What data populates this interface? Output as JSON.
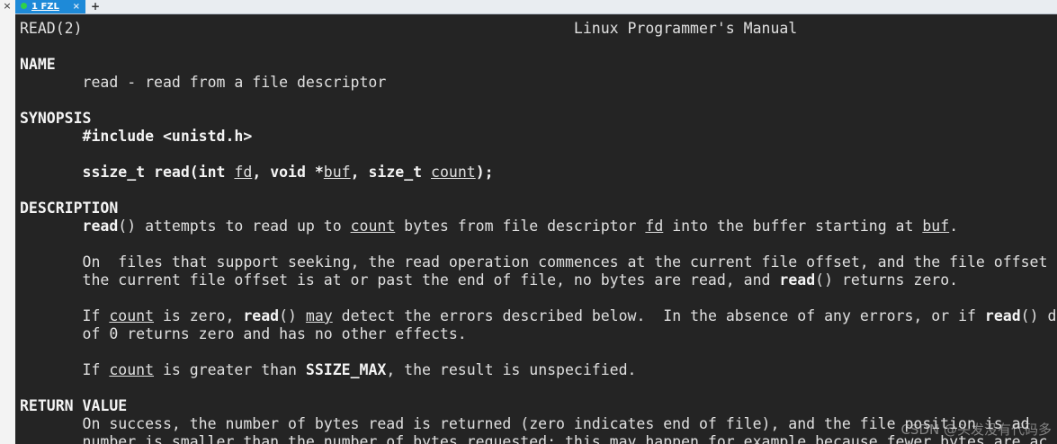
{
  "window": {
    "gutter_close": "×"
  },
  "tabs": [
    {
      "label": "1 FZL",
      "close": "×",
      "active": true,
      "status_color": "#2fd14a"
    }
  ],
  "tab_add": "+",
  "colors": {
    "terminal_bg": "#242424",
    "terminal_fg": "#e0e0e0",
    "tab_active": "#1e8ad8"
  },
  "man": {
    "lines": [
      [
        {
          "t": "READ(2)                                                       Linux Programmer's Manual"
        }
      ],
      [],
      [
        {
          "t": "NAME",
          "b": true
        }
      ],
      [
        {
          "t": "       read - read from a file descriptor"
        }
      ],
      [],
      [
        {
          "t": "SYNOPSIS",
          "b": true
        }
      ],
      [
        {
          "t": "       "
        },
        {
          "t": "#include <unistd.h>",
          "b": true
        }
      ],
      [],
      [
        {
          "t": "       "
        },
        {
          "t": "ssize_t read(int ",
          "b": true
        },
        {
          "t": "fd",
          "u": true
        },
        {
          "t": ", ",
          "b": true
        },
        {
          "t": "void *",
          "b": true
        },
        {
          "t": "buf",
          "u": true
        },
        {
          "t": ", ",
          "b": true
        },
        {
          "t": "size_t ",
          "b": true
        },
        {
          "t": "count",
          "u": true
        },
        {
          "t": ");",
          "b": true
        }
      ],
      [],
      [
        {
          "t": "DESCRIPTION",
          "b": true
        }
      ],
      [
        {
          "t": "       "
        },
        {
          "t": "read",
          "b": true
        },
        {
          "t": "() attempts to read up to "
        },
        {
          "t": "count",
          "u": true
        },
        {
          "t": " bytes from file descriptor "
        },
        {
          "t": "fd",
          "u": true
        },
        {
          "t": " into the buffer starting at "
        },
        {
          "t": "buf",
          "u": true
        },
        {
          "t": "."
        }
      ],
      [],
      [
        {
          "t": "       On  files that support seeking, the read operation commences at the current file offset, and the file offset"
        }
      ],
      [
        {
          "t": "       the current file offset is at or past the end of file, no bytes are read, and "
        },
        {
          "t": "read",
          "b": true
        },
        {
          "t": "() returns zero."
        }
      ],
      [],
      [
        {
          "t": "       If "
        },
        {
          "t": "count",
          "u": true
        },
        {
          "t": " is zero, "
        },
        {
          "t": "read",
          "b": true
        },
        {
          "t": "() "
        },
        {
          "t": "may",
          "u": true
        },
        {
          "t": " detect the errors described below.  In the absence of any errors, or if "
        },
        {
          "t": "read",
          "b": true
        },
        {
          "t": "() d"
        }
      ],
      [
        {
          "t": "       of 0 returns zero and has no other effects."
        }
      ],
      [],
      [
        {
          "t": "       If "
        },
        {
          "t": "count",
          "u": true
        },
        {
          "t": " is greater than "
        },
        {
          "t": "SSIZE_MAX",
          "b": true
        },
        {
          "t": ", the result is unspecified."
        }
      ],
      [],
      [
        {
          "t": "RETURN VALUE",
          "b": true
        }
      ],
      [
        {
          "t": "       On success, the number of bytes read is returned (zero indicates end of file), and the file position is ad"
        }
      ],
      [
        {
          "t": "       number is smaller than the number of bytes requested; this may happen for example because fewer bytes are ac"
        }
      ]
    ]
  },
  "watermark": "CSDN @头发没有代码多"
}
